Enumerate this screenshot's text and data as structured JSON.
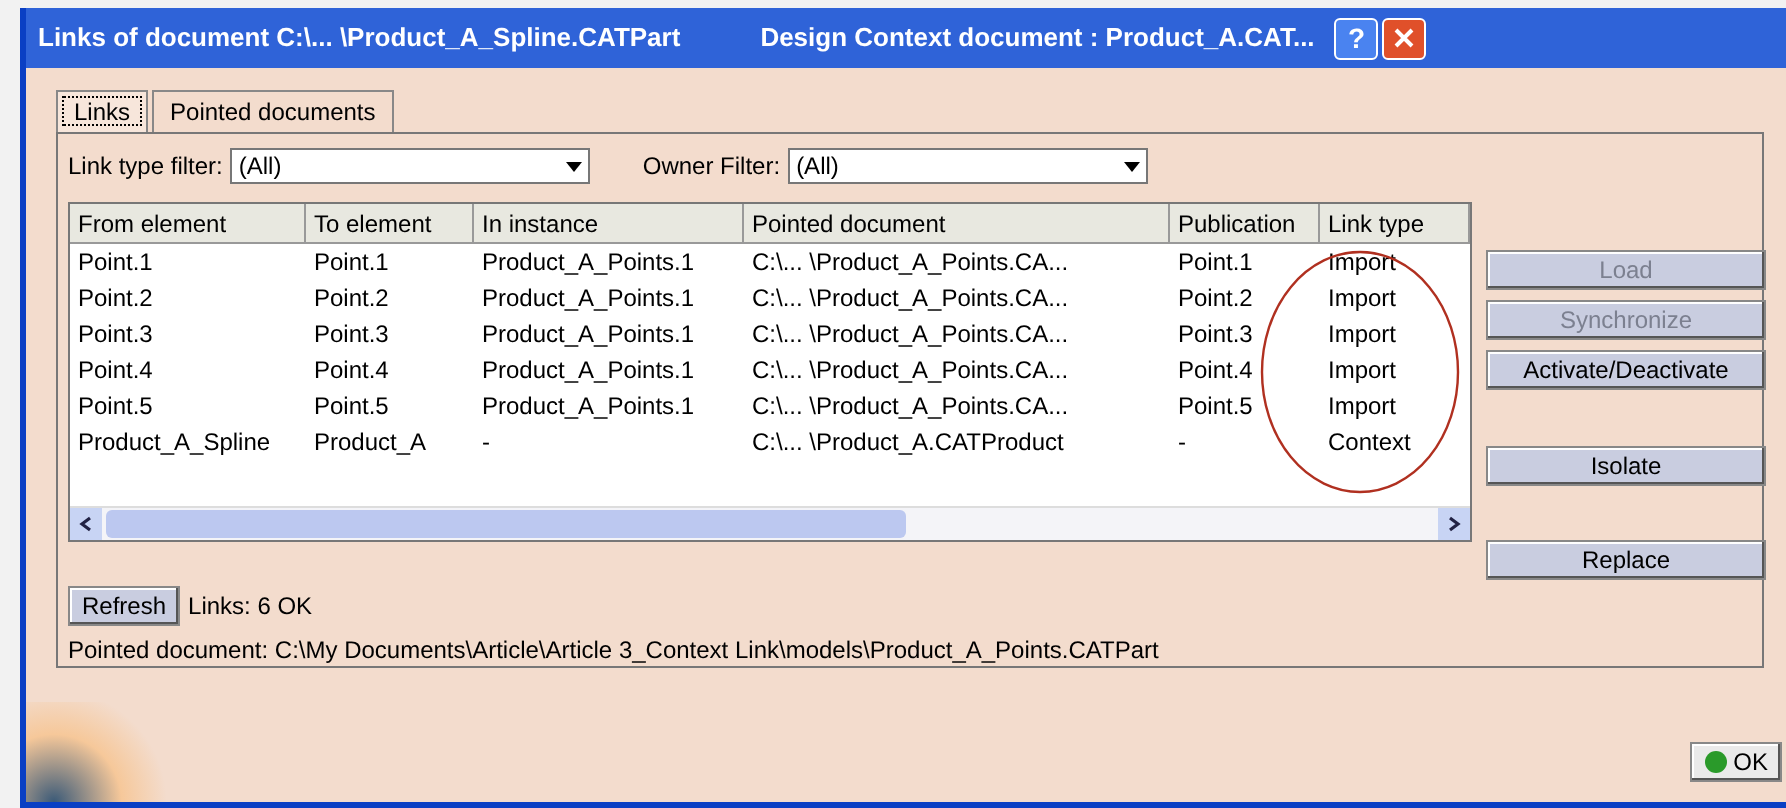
{
  "window": {
    "title": "Links of document C:\\... \\Product_A_Spline.CATPart",
    "subtitle": "Design Context document : Product_A.CAT..."
  },
  "title_buttons": [
    "?"
  ],
  "tabs": [
    {
      "label": "Links",
      "selected": true
    },
    {
      "label": "Pointed documents",
      "selected": false
    }
  ],
  "filters": [
    {
      "label": "Link type filter:",
      "value": "(All)"
    },
    {
      "label": "Owner Filter:",
      "value": "(All)"
    }
  ],
  "table": {
    "columns": [
      "From element",
      "To element",
      "In instance",
      "Pointed document",
      "Publication",
      "Link type"
    ],
    "rows": [
      [
        "Point.1",
        "Point.1",
        "Product_A_Points.1",
        "C:\\... \\Product_A_Points.CA...",
        "Point.1",
        "Import"
      ],
      [
        "Point.2",
        "Point.2",
        "Product_A_Points.1",
        "C:\\... \\Product_A_Points.CA...",
        "Point.2",
        "Import"
      ],
      [
        "Point.3",
        "Point.3",
        "Product_A_Points.1",
        "C:\\... \\Product_A_Points.CA...",
        "Point.3",
        "Import"
      ],
      [
        "Point.4",
        "Point.4",
        "Product_A_Points.1",
        "C:\\... \\Product_A_Points.CA...",
        "Point.4",
        "Import"
      ],
      [
        "Point.5",
        "Point.5",
        "Product_A_Points.1",
        "C:\\... \\Product_A_Points.CA...",
        "Point.5",
        "Import"
      ],
      [
        "Product_A_Spline",
        "Product_A",
        "-",
        "C:\\... \\Product_A.CATProduct",
        "-",
        "Context"
      ]
    ]
  },
  "side_buttons": [
    {
      "label": "Load",
      "disabled": true
    },
    {
      "label": "Synchronize",
      "disabled": true
    },
    {
      "label": "Activate/Deactivate",
      "disabled": false
    },
    {
      "label": "Isolate",
      "disabled": false
    },
    {
      "label": "Replace",
      "disabled": false
    }
  ],
  "refresh_button": "Refresh",
  "links_status": "Links: 6 OK",
  "pointed_document": "Pointed document: C:\\My Documents\\Article\\Article 3_Context Link\\models\\Product_A_Points.CATPart",
  "ok_button": "OK"
}
